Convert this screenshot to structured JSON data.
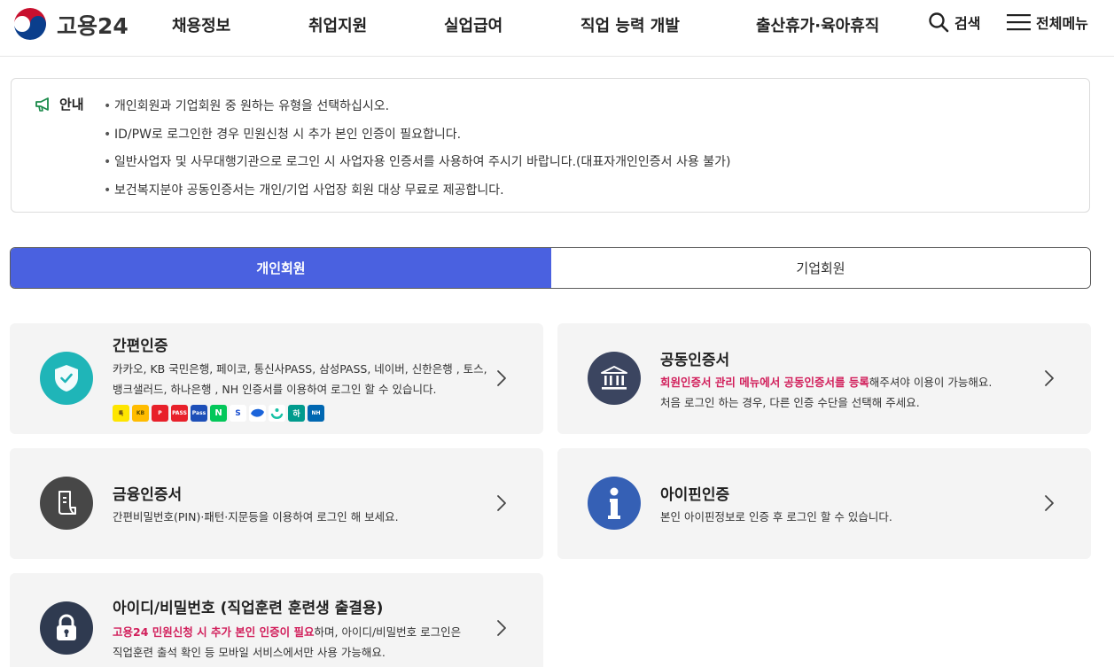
{
  "header": {
    "logo_text": "고용24",
    "nav": [
      "채용정보",
      "취업지원",
      "실업급여",
      "직업 능력 개발",
      "출산휴가·육아휴직"
    ],
    "search_label": "검색",
    "menu_label": "전체메뉴"
  },
  "notice": {
    "label": "안내",
    "items": [
      "개인회원과 기업회원 중 원하는 유형을 선택하십시오.",
      "ID/PW로 로그인한 경우 민원신청 시 추가 본인 인증이 필요합니다.",
      "일반사업자 및 사무대행기관으로 로그인 시 사업자용 인증서를 사용하여 주시기 바랍니다.(대표자개인인증서 사용 불가)",
      "보건복지분야 공동인증서는 개인/기업 사업장 회원 대상 무료로 제공합니다."
    ]
  },
  "tabs": {
    "personal": "개인회원",
    "business": "기업회원"
  },
  "cards": {
    "simple": {
      "title": "간편인증",
      "line1": "카카오, KB 국민은행, 페이코, 통신사PASS, 삼성PASS, 네이버, 신한은행 , 토스,",
      "line2": "뱅크샐러드, 하나은행 , NH 인증서를 이용하여 로그인 할 수 있습니다.",
      "icon_color": "#1fb5b8"
    },
    "joint": {
      "title": "공동인증서",
      "line1_highlight": "회원인증서 관리 메뉴에서 공동인증서를 등록",
      "line1_rest": "해주셔야 이용이 가능해요.",
      "line2": "처음 로그인 하는 경우, 다른 인증 수단을 선택해 주세요.",
      "icon_color": "#3b4560"
    },
    "financial": {
      "title": "금융인증서",
      "line1": "간편비밀번호(PIN)·패턴·지문등을 이용하여 로그인 해 보세요.",
      "icon_color": "#474747"
    },
    "ipin": {
      "title": "아이핀인증",
      "line1": "본인 아이핀정보로 인증 후 로그인 할 수 있습니다.",
      "icon_color": "#3560b5"
    },
    "idpw": {
      "title": "아이디/비밀번호 (직업훈련 훈련생 출결용)",
      "line1_highlight": "고용24 민원신청 시 추가 본인 인증이 필요",
      "line1_rest": "하며, 아이디/비밀번호 로그인은",
      "line2": "직업훈련 출석 확인 등 모바일 서비스에서만 사용 가능해요.",
      "icon_color": "#2f3a50"
    }
  },
  "colors": {
    "accent": "#4a61e0",
    "highlight": "#d11f5b",
    "card_bg": "#f4f4f4"
  }
}
